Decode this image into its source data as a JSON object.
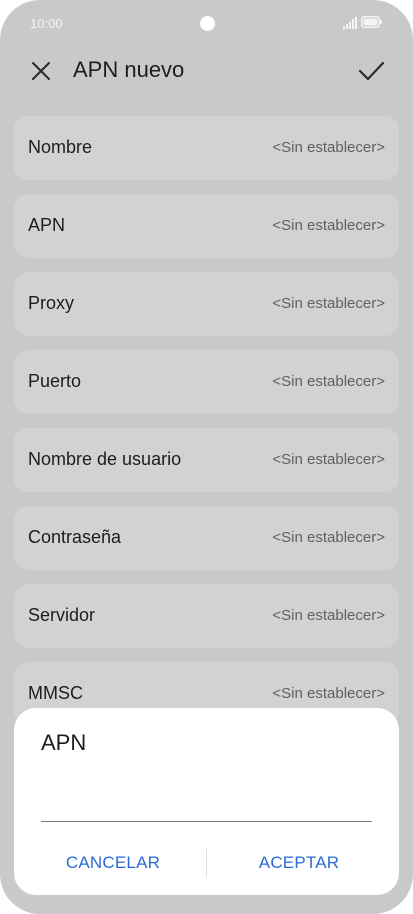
{
  "status_bar": {
    "time": "10:00",
    "icons": [
      "signal-icon",
      "battery-icon"
    ]
  },
  "header": {
    "title": "APN nuevo",
    "close_icon": "close-icon",
    "confirm_icon": "check-icon"
  },
  "fields": [
    {
      "label": "Nombre",
      "value": "<Sin establecer>"
    },
    {
      "label": "APN",
      "value": "<Sin establecer>"
    },
    {
      "label": "Proxy",
      "value": "<Sin establecer>"
    },
    {
      "label": "Puerto",
      "value": "<Sin establecer>"
    },
    {
      "label": "Nombre de usuario",
      "value": "<Sin establecer>"
    },
    {
      "label": "Contraseña",
      "value": "<Sin establecer>"
    },
    {
      "label": "Servidor",
      "value": "<Sin establecer>"
    },
    {
      "label": "MMSC",
      "value": "<Sin establecer>"
    }
  ],
  "dialog": {
    "title": "APN",
    "input_value": "",
    "cancel_label": "CANCELAR",
    "ok_label": "ACEPTAR"
  },
  "colors": {
    "overlay_background": "#c9c9c9",
    "field_background": "#d2d2d2",
    "accent": "#2a6bd6"
  }
}
